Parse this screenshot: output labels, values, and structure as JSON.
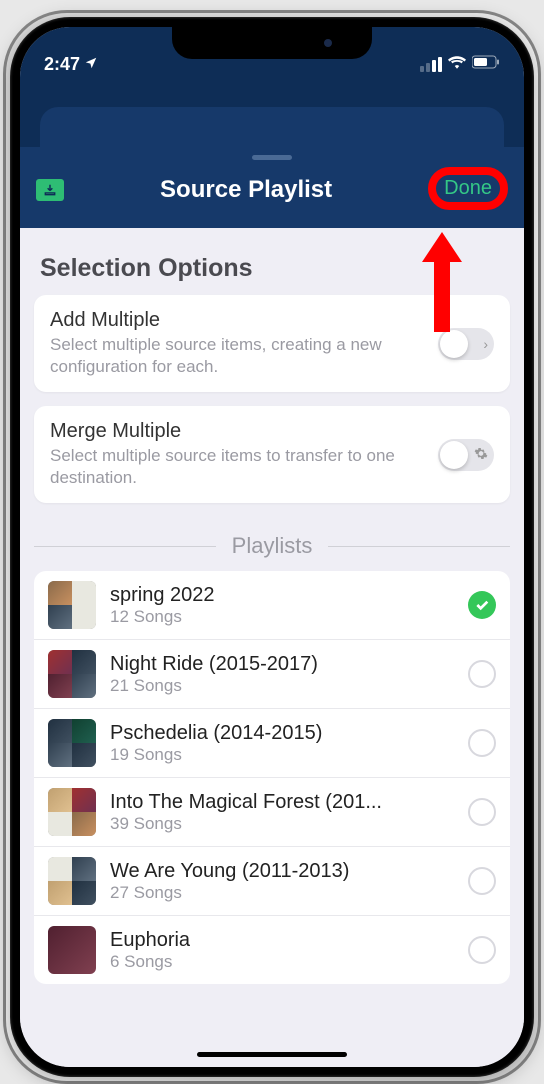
{
  "status": {
    "time": "2:47"
  },
  "header": {
    "title": "Source Playlist",
    "done_label": "Done"
  },
  "sections": {
    "selection_header": "Selection Options",
    "options": [
      {
        "title": "Add Multiple",
        "sub": "Select multiple source items, creating a new configuration for each."
      },
      {
        "title": "Merge Multiple",
        "sub": "Select multiple source items to transfer to one destination."
      }
    ],
    "playlists_header": "Playlists"
  },
  "playlists": [
    {
      "name": "spring 2022",
      "sub": "12 Songs",
      "selected": true
    },
    {
      "name": "Night Ride (2015-2017)",
      "sub": "21 Songs",
      "selected": false
    },
    {
      "name": "Pschedelia (2014-2015)",
      "sub": "19 Songs",
      "selected": false
    },
    {
      "name": "Into The Magical Forest (201...",
      "sub": "39 Songs",
      "selected": false
    },
    {
      "name": "We Are Young (2011-2013)",
      "sub": "27 Songs",
      "selected": false
    },
    {
      "name": "Euphoria",
      "sub": "6 Songs",
      "selected": false
    }
  ]
}
